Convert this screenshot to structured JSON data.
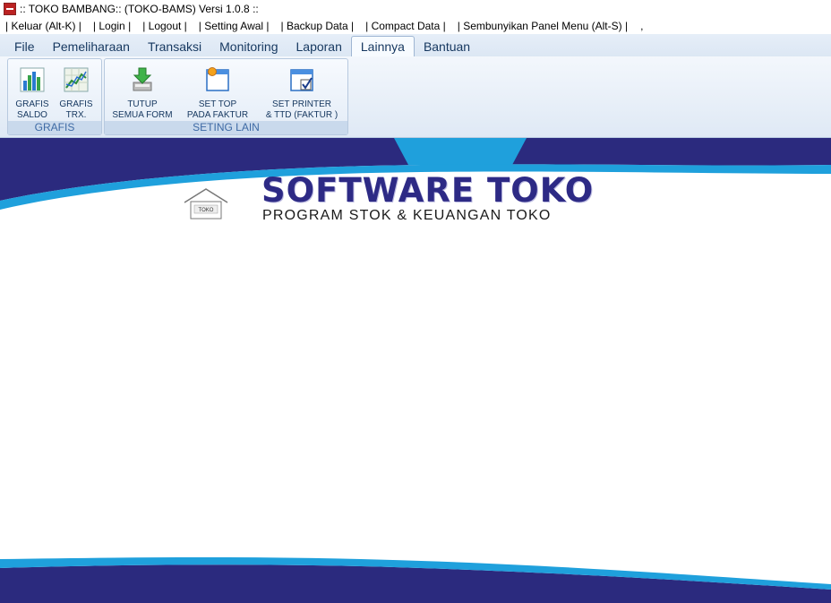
{
  "window": {
    "title": ":: TOKO BAMBANG:: (TOKO-BAMS) Versi 1.0.8 ::"
  },
  "menu": [
    "| Keluar (Alt-K) |",
    "| Login |",
    "| Logout |",
    "| Setting Awal |",
    "| Backup Data |",
    "| Compact Data |",
    "| Sembunyikan Panel Menu (Alt-S) |",
    ","
  ],
  "tabs": [
    "File",
    "Pemeliharaan",
    "Transaksi",
    "Monitoring",
    "Laporan",
    "Lainnya",
    "Bantuan"
  ],
  "active_tab": "Lainnya",
  "ribbon": {
    "grafis": {
      "label": "GRAFIS",
      "buttons": [
        {
          "line1": "GRAFIS",
          "line2": "SALDO",
          "icon": "bar-chart-icon"
        },
        {
          "line1": "GRAFIS",
          "line2": "TRX.",
          "icon": "line-chart-icon"
        }
      ]
    },
    "seting": {
      "label": "SETING LAIN",
      "buttons": [
        {
          "line1": "TUTUP",
          "line2": "SEMUA FORM",
          "icon": "download-close-icon"
        },
        {
          "line1": "SET TOP",
          "line2": "PADA FAKTUR",
          "icon": "window-star-icon"
        },
        {
          "line1": "SET PRINTER",
          "line2": "& TTD (FAKTUR )",
          "icon": "window-check-icon"
        }
      ]
    }
  },
  "banner": {
    "title": "SOFTWARE TOKO",
    "subtitle": "PROGRAM  STOK & KEUANGAN  TOKO",
    "shop_sign": "TOKO"
  },
  "colors": {
    "navy": "#2b2a7e",
    "cyan": "#1fa0dc",
    "ribbon": "#dfe9f5"
  }
}
